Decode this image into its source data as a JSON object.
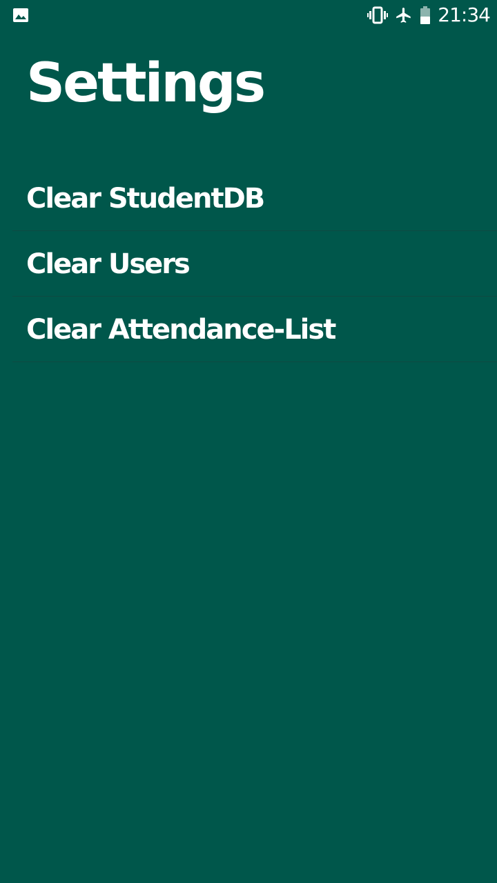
{
  "status_bar": {
    "left_icon": "image-icon",
    "icons": [
      "vibrate-icon",
      "airplane-mode-icon",
      "battery-icon"
    ],
    "time": "21:34"
  },
  "page": {
    "title": "Settings",
    "background_color": "#00574B"
  },
  "settings": {
    "items": [
      {
        "label": "Clear StudentDB"
      },
      {
        "label": "Clear Users"
      },
      {
        "label": "Clear Attendance-List"
      }
    ]
  }
}
